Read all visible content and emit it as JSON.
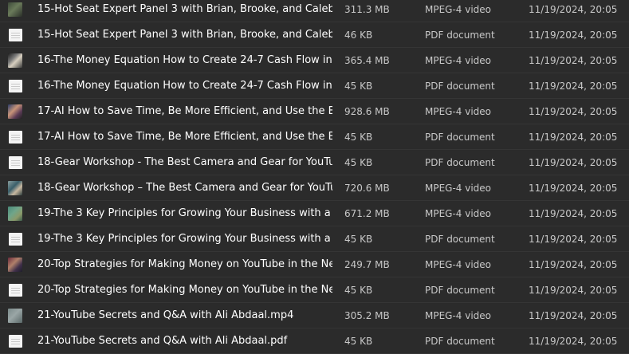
{
  "files": [
    {
      "name": "15-Hot Seat Expert Panel 3 with Brian, Brooke, and Caleb ...",
      "size": "311.3 MB",
      "type": "MPEG-4 video",
      "modified": "11/19/2024, 20:05",
      "icon": "video-thumbnail-icon"
    },
    {
      "name": "15-Hot Seat Expert Panel 3 with Brian, Brooke, and Caleb ...",
      "size": "46 KB",
      "type": "PDF document",
      "modified": "11/19/2024, 20:05",
      "icon": "pdf-document-icon"
    },
    {
      "name": "16-The Money Equation How to Create 24-7 Cash Flow in...",
      "size": "365.4 MB",
      "type": "MPEG-4 video",
      "modified": "11/19/2024, 20:05",
      "icon": "video-thumbnail-icon"
    },
    {
      "name": "16-The Money Equation How to Create 24-7 Cash Flow in...",
      "size": "45 KB",
      "type": "PDF document",
      "modified": "11/19/2024, 20:05",
      "icon": "pdf-document-icon"
    },
    {
      "name": "17-AI How to Save Time, Be More Efficient, and Use the B...",
      "size": "928.6 MB",
      "type": "MPEG-4 video",
      "modified": "11/19/2024, 20:05",
      "icon": "video-thumbnail-icon"
    },
    {
      "name": "17-AI How to Save Time, Be More Efficient, and Use the B...",
      "size": "45 KB",
      "type": "PDF document",
      "modified": "11/19/2024, 20:05",
      "icon": "pdf-document-icon"
    },
    {
      "name": "18-Gear Workshop - The Best Camera and Gear for YouTu...",
      "size": "45 KB",
      "type": "PDF document",
      "modified": "11/19/2024, 20:05",
      "icon": "pdf-document-icon"
    },
    {
      "name": "18-Gear Workshop – The Best Camera and Gear for YouTu...",
      "size": "720.6 MB",
      "type": "MPEG-4 video",
      "modified": "11/19/2024, 20:05",
      "icon": "video-thumbnail-icon"
    },
    {
      "name": "19-The 3 Key Principles for Growing Your Business with a ...",
      "size": "671.2 MB",
      "type": "MPEG-4 video",
      "modified": "11/19/2024, 20:05",
      "icon": "video-thumbnail-icon"
    },
    {
      "name": "19-The 3 Key Principles for Growing Your Business with a ...",
      "size": "45 KB",
      "type": "PDF document",
      "modified": "11/19/2024, 20:05",
      "icon": "pdf-document-icon"
    },
    {
      "name": "20-Top Strategies for Making Money on YouTube in the Ne...",
      "size": "249.7 MB",
      "type": "MPEG-4 video",
      "modified": "11/19/2024, 20:05",
      "icon": "video-thumbnail-icon"
    },
    {
      "name": "20-Top Strategies for Making Money on YouTube in the Ne...",
      "size": "45 KB",
      "type": "PDF document",
      "modified": "11/19/2024, 20:05",
      "icon": "pdf-document-icon"
    },
    {
      "name": "21-YouTube Secrets and Q&A with Ali Abdaal.mp4",
      "size": "305.2 MB",
      "type": "MPEG-4 video",
      "modified": "11/19/2024, 20:05",
      "icon": "video-thumbnail-icon"
    },
    {
      "name": "21-YouTube Secrets and Q&A with Ali Abdaal.pdf",
      "size": "45 KB",
      "type": "PDF document",
      "modified": "11/19/2024, 20:05",
      "icon": "pdf-document-icon"
    }
  ],
  "colors": {
    "background": "#2b2b2b",
    "row_divider": "#353535",
    "name_text": "#ffffff",
    "meta_text": "#c8c8c8"
  }
}
